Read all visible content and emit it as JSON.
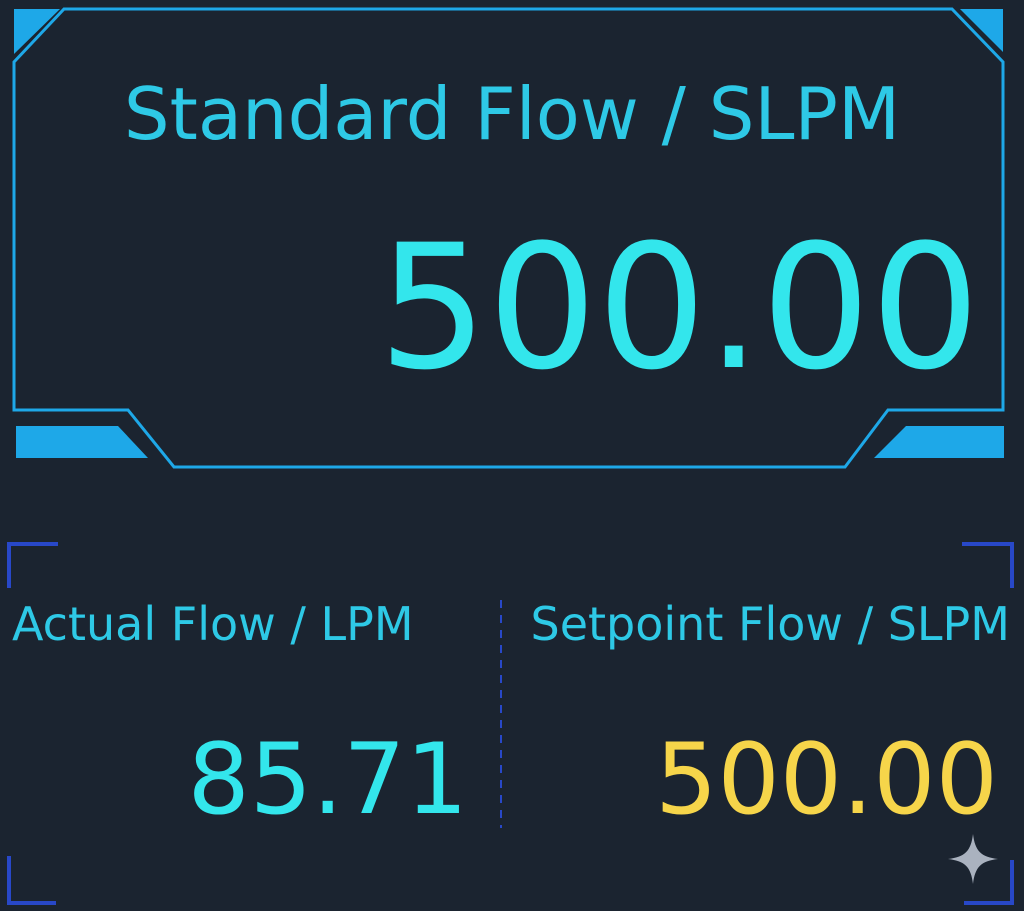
{
  "main_panel": {
    "title": "Standard Flow / SLPM",
    "value": "500.00"
  },
  "actual_panel": {
    "label": "Actual Flow / LPM",
    "value": "85.71"
  },
  "setpoint_panel": {
    "label": "Setpoint Flow / SLPM",
    "value": "500.00"
  },
  "colors": {
    "background": "#1b2430",
    "frame": "#1ea8e8",
    "primary_value": "#33e6ec",
    "label_text": "#2ec9e6",
    "setpoint_value": "#f6d54a",
    "corner_brackets": "#2848c8"
  },
  "icons": {
    "watermark": "sparkle-icon"
  }
}
